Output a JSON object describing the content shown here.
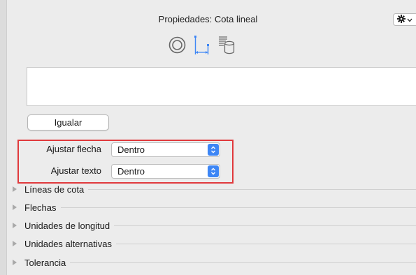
{
  "title": "Propiedades: Cota lineal",
  "gear_menu": {
    "icon": "gear-icon",
    "chevron": "chevron-down-icon"
  },
  "tabs": [
    {
      "name": "tab-symbol",
      "icon": "concentric-circles-icon"
    },
    {
      "name": "tab-dimension",
      "icon": "linear-dimension-icon"
    },
    {
      "name": "tab-data",
      "icon": "database-icon"
    }
  ],
  "match_button": {
    "label": "Igualar"
  },
  "arrow_fit": {
    "label": "Ajustar flecha",
    "value": "Dentro"
  },
  "text_fit": {
    "label": "Ajustar texto",
    "value": "Dentro"
  },
  "highlight_color": "#e0393c",
  "accent_color": "#3d86f5",
  "sections": [
    "Líneas de cota",
    "Flechas",
    "Unidades de longitud",
    "Unidades alternativas",
    "Tolerancia"
  ]
}
